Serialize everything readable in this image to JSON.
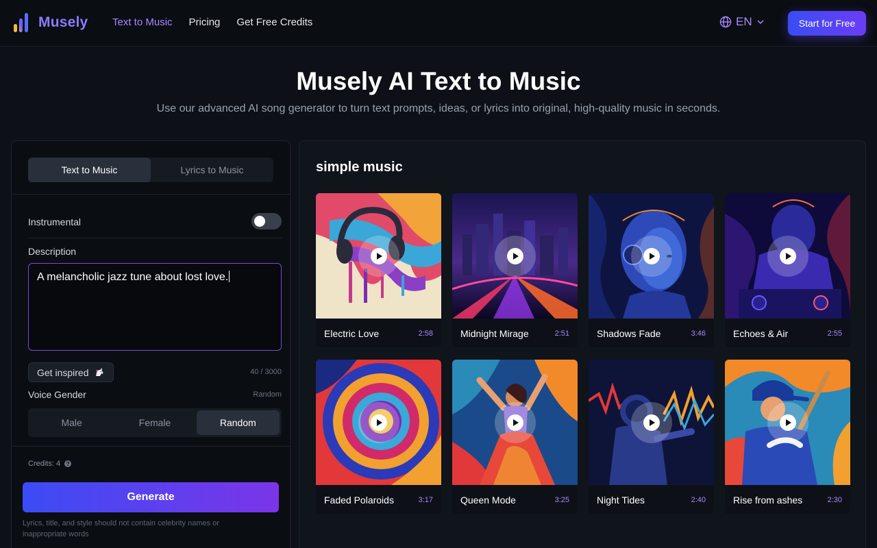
{
  "header": {
    "brand": "Musely",
    "nav": [
      {
        "label": "Text to Music",
        "active": true
      },
      {
        "label": "Pricing",
        "active": false
      },
      {
        "label": "Get Free Credits",
        "active": false
      }
    ],
    "language": "EN",
    "cta": "Start for Free"
  },
  "hero": {
    "title": "Musely AI Text to Music",
    "subtitle": "Use our advanced AI song generator to turn text prompts, ideas, or lyrics into original, high-quality music in seconds."
  },
  "form": {
    "tabs": [
      "Text to Music",
      "Lyrics to Music"
    ],
    "active_tab": "Text to Music",
    "instrumental_label": "Instrumental",
    "instrumental_on": false,
    "description_label": "Description",
    "description_value": "A melancholic jazz tune about lost love.",
    "inspire_label": "Get inspired",
    "char_count": "40 / 3000",
    "voice_gender_label": "Voice Gender",
    "voice_gender_value": "Random",
    "gender_options": [
      "Male",
      "Female",
      "Random"
    ],
    "credits": "Credits: 4",
    "generate_label": "Generate",
    "disclaimer": "Lyrics, title, and style should not contain celebrity names or inappropriate words"
  },
  "gallery": {
    "title": "simple music",
    "tracks": [
      {
        "title": "Electric Love",
        "duration": "2:58"
      },
      {
        "title": "Midnight Mirage",
        "duration": "2:51"
      },
      {
        "title": "Shadows Fade",
        "duration": "3:46"
      },
      {
        "title": "Echoes & Air",
        "duration": "2:55"
      },
      {
        "title": "Faded Polaroids",
        "duration": "3:17"
      },
      {
        "title": "Queen Mode",
        "duration": "3:25"
      },
      {
        "title": "Night Tides",
        "duration": "2:40"
      },
      {
        "title": "Rise from ashes",
        "duration": "2:30"
      }
    ]
  },
  "colors": {
    "accent": "#a889ff",
    "button_gradient_start": "#3b4cf5",
    "button_gradient_end": "#7b35e8",
    "background": "#0d1117"
  }
}
